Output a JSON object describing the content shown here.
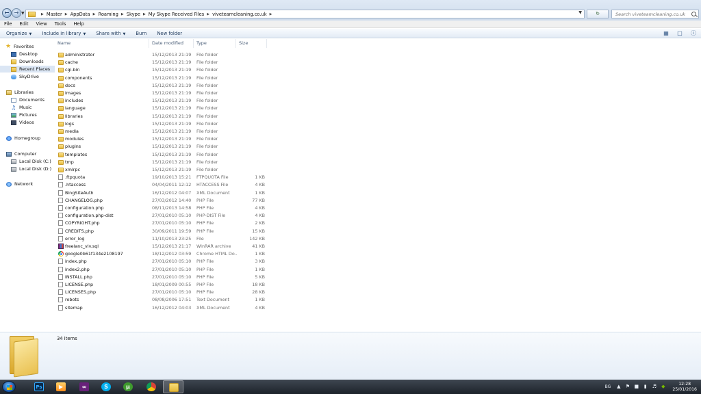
{
  "address": {
    "breadcrumbs": [
      "Master",
      "AppData",
      "Roaming",
      "Skype",
      "My Skype Received Files",
      "viveteamcleaning.co.uk"
    ],
    "search_placeholder": "Search viveteamcleaning.co.uk"
  },
  "menu": [
    "File",
    "Edit",
    "View",
    "Tools",
    "Help"
  ],
  "commands": {
    "organize": "Organize",
    "include": "Include in library",
    "share": "Share with",
    "burn": "Burn",
    "new_folder": "New folder"
  },
  "nav": {
    "favorites": "Favorites",
    "desktop": "Desktop",
    "downloads": "Downloads",
    "recent": "Recent Places",
    "skydrive": "SkyDrive",
    "libraries": "Libraries",
    "documents": "Documents",
    "music": "Music",
    "pictures": "Pictures",
    "videos": "Videos",
    "homegroup": "Homegroup",
    "computer": "Computer",
    "disk_c": "Local Disk (C:)",
    "disk_d": "Local Disk (D:)",
    "network": "Network"
  },
  "columns": {
    "name": "Name",
    "date": "Date modified",
    "type": "Type",
    "size": "Size"
  },
  "files": [
    {
      "name": "administrator",
      "date": "15/12/2013 21:19",
      "type": "File folder",
      "size": "",
      "icon": "folder"
    },
    {
      "name": "cache",
      "date": "15/12/2013 21:19",
      "type": "File folder",
      "size": "",
      "icon": "folder"
    },
    {
      "name": "cgi-bin",
      "date": "15/12/2013 21:19",
      "type": "File folder",
      "size": "",
      "icon": "folder"
    },
    {
      "name": "components",
      "date": "15/12/2013 21:19",
      "type": "File folder",
      "size": "",
      "icon": "folder"
    },
    {
      "name": "docs",
      "date": "15/12/2013 21:19",
      "type": "File folder",
      "size": "",
      "icon": "folder"
    },
    {
      "name": "images",
      "date": "15/12/2013 21:19",
      "type": "File folder",
      "size": "",
      "icon": "folder"
    },
    {
      "name": "includes",
      "date": "15/12/2013 21:19",
      "type": "File folder",
      "size": "",
      "icon": "folder"
    },
    {
      "name": "language",
      "date": "15/12/2013 21:19",
      "type": "File folder",
      "size": "",
      "icon": "folder"
    },
    {
      "name": "libraries",
      "date": "15/12/2013 21:19",
      "type": "File folder",
      "size": "",
      "icon": "folder"
    },
    {
      "name": "logs",
      "date": "15/12/2013 21:19",
      "type": "File folder",
      "size": "",
      "icon": "folder"
    },
    {
      "name": "media",
      "date": "15/12/2013 21:19",
      "type": "File folder",
      "size": "",
      "icon": "folder"
    },
    {
      "name": "modules",
      "date": "15/12/2013 21:19",
      "type": "File folder",
      "size": "",
      "icon": "folder"
    },
    {
      "name": "plugins",
      "date": "15/12/2013 21:19",
      "type": "File folder",
      "size": "",
      "icon": "folder"
    },
    {
      "name": "templates",
      "date": "15/12/2013 21:19",
      "type": "File folder",
      "size": "",
      "icon": "folder"
    },
    {
      "name": "tmp",
      "date": "15/12/2013 21:19",
      "type": "File folder",
      "size": "",
      "icon": "folder"
    },
    {
      "name": "xmlrpc",
      "date": "15/12/2013 21:19",
      "type": "File folder",
      "size": "",
      "icon": "folder"
    },
    {
      "name": ".ftpquota",
      "date": "19/10/2013 15:21",
      "type": "FTPQUOTA File",
      "size": "1 KB",
      "icon": "file"
    },
    {
      "name": ".htaccess",
      "date": "04/04/2011 12:12",
      "type": "HTACCESS File",
      "size": "4 KB",
      "icon": "file"
    },
    {
      "name": "BingSiteAuth",
      "date": "16/12/2012 04:07",
      "type": "XML Document",
      "size": "1 KB",
      "icon": "xml"
    },
    {
      "name": "CHANGELOG.php",
      "date": "27/03/2012 14:40",
      "type": "PHP File",
      "size": "77 KB",
      "icon": "file"
    },
    {
      "name": "configuration.php",
      "date": "08/11/2013 14:58",
      "type": "PHP File",
      "size": "4 KB",
      "icon": "file"
    },
    {
      "name": "configuration.php-dist",
      "date": "27/01/2010 05:10",
      "type": "PHP-DIST File",
      "size": "4 KB",
      "icon": "file"
    },
    {
      "name": "COPYRIGHT.php",
      "date": "27/01/2010 05:10",
      "type": "PHP File",
      "size": "2 KB",
      "icon": "file"
    },
    {
      "name": "CREDITS.php",
      "date": "30/09/2011 19:59",
      "type": "PHP File",
      "size": "15 KB",
      "icon": "file"
    },
    {
      "name": "error_log",
      "date": "11/10/2013 23:25",
      "type": "File",
      "size": "142 KB",
      "icon": "file"
    },
    {
      "name": "freelanc_viv.sql",
      "date": "15/12/2013 21:17",
      "type": "WinRAR archive",
      "size": "41 KB",
      "icon": "rar"
    },
    {
      "name": "google0b61f134e2108197",
      "date": "18/12/2012 03:59",
      "type": "Chrome HTML Do...",
      "size": "1 KB",
      "icon": "chrome"
    },
    {
      "name": "index.php",
      "date": "27/01/2010 05:10",
      "type": "PHP File",
      "size": "3 KB",
      "icon": "file"
    },
    {
      "name": "index2.php",
      "date": "27/01/2010 05:10",
      "type": "PHP File",
      "size": "1 KB",
      "icon": "file"
    },
    {
      "name": "INSTALL.php",
      "date": "27/01/2010 05:10",
      "type": "PHP File",
      "size": "5 KB",
      "icon": "file"
    },
    {
      "name": "LICENSE.php",
      "date": "18/01/2009 00:55",
      "type": "PHP File",
      "size": "18 KB",
      "icon": "file"
    },
    {
      "name": "LICENSES.php",
      "date": "27/01/2010 05:10",
      "type": "PHP File",
      "size": "28 KB",
      "icon": "file"
    },
    {
      "name": "robots",
      "date": "08/08/2006 17:51",
      "type": "Text Document",
      "size": "1 KB",
      "icon": "file"
    },
    {
      "name": "sitemap",
      "date": "16/12/2012 04:03",
      "type": "XML Document",
      "size": "4 KB",
      "icon": "xml"
    }
  ],
  "details": {
    "item_count": "34 items"
  },
  "taskbar": {
    "photoshop": "Ps",
    "lang": "BG",
    "time": "12:28",
    "date": "25/01/2016"
  },
  "colors": {
    "accent": "#1e395b",
    "selection": "#dbe6f4",
    "folder": "#e7bb3c"
  }
}
